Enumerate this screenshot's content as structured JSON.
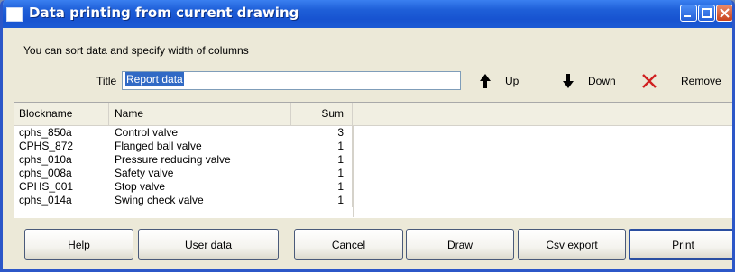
{
  "window": {
    "title": "Data printing from current drawing",
    "controls": [
      "minimize-icon",
      "maximize-icon",
      "close-icon"
    ]
  },
  "subtitle": "You can sort data and specify width of columns",
  "title_field": {
    "label": "Title",
    "value": "Report data"
  },
  "toolbar": {
    "up": {
      "label": "Up",
      "icon": "arrow-up-icon"
    },
    "down": {
      "label": "Down",
      "icon": "arrow-down-icon"
    },
    "remove": {
      "label": "Remove",
      "icon": "remove-x-icon",
      "color": "#d02020"
    }
  },
  "table": {
    "columns": [
      "Blockname",
      "Name",
      "Sum"
    ],
    "rows": [
      [
        "cphs_850a",
        "Control valve",
        "3"
      ],
      [
        "CPHS_872",
        "Flanged ball valve",
        "1"
      ],
      [
        "cphs_010a",
        "Pressure reducing valve",
        "1"
      ],
      [
        "cphs_008a",
        "Safety valve",
        "1"
      ],
      [
        "CPHS_001",
        "Stop valve",
        "1"
      ],
      [
        "cphs_014a",
        "Swing check valve",
        "1"
      ]
    ]
  },
  "buttons": {
    "help": "Help",
    "user_data": "User data",
    "cancel": "Cancel",
    "draw": "Draw",
    "csv_export": "Csv export",
    "print": "Print"
  },
  "colors": {
    "titlebar": "#1e5fd8",
    "window_bg": "#ece9d8",
    "selection": "#316ac5"
  }
}
